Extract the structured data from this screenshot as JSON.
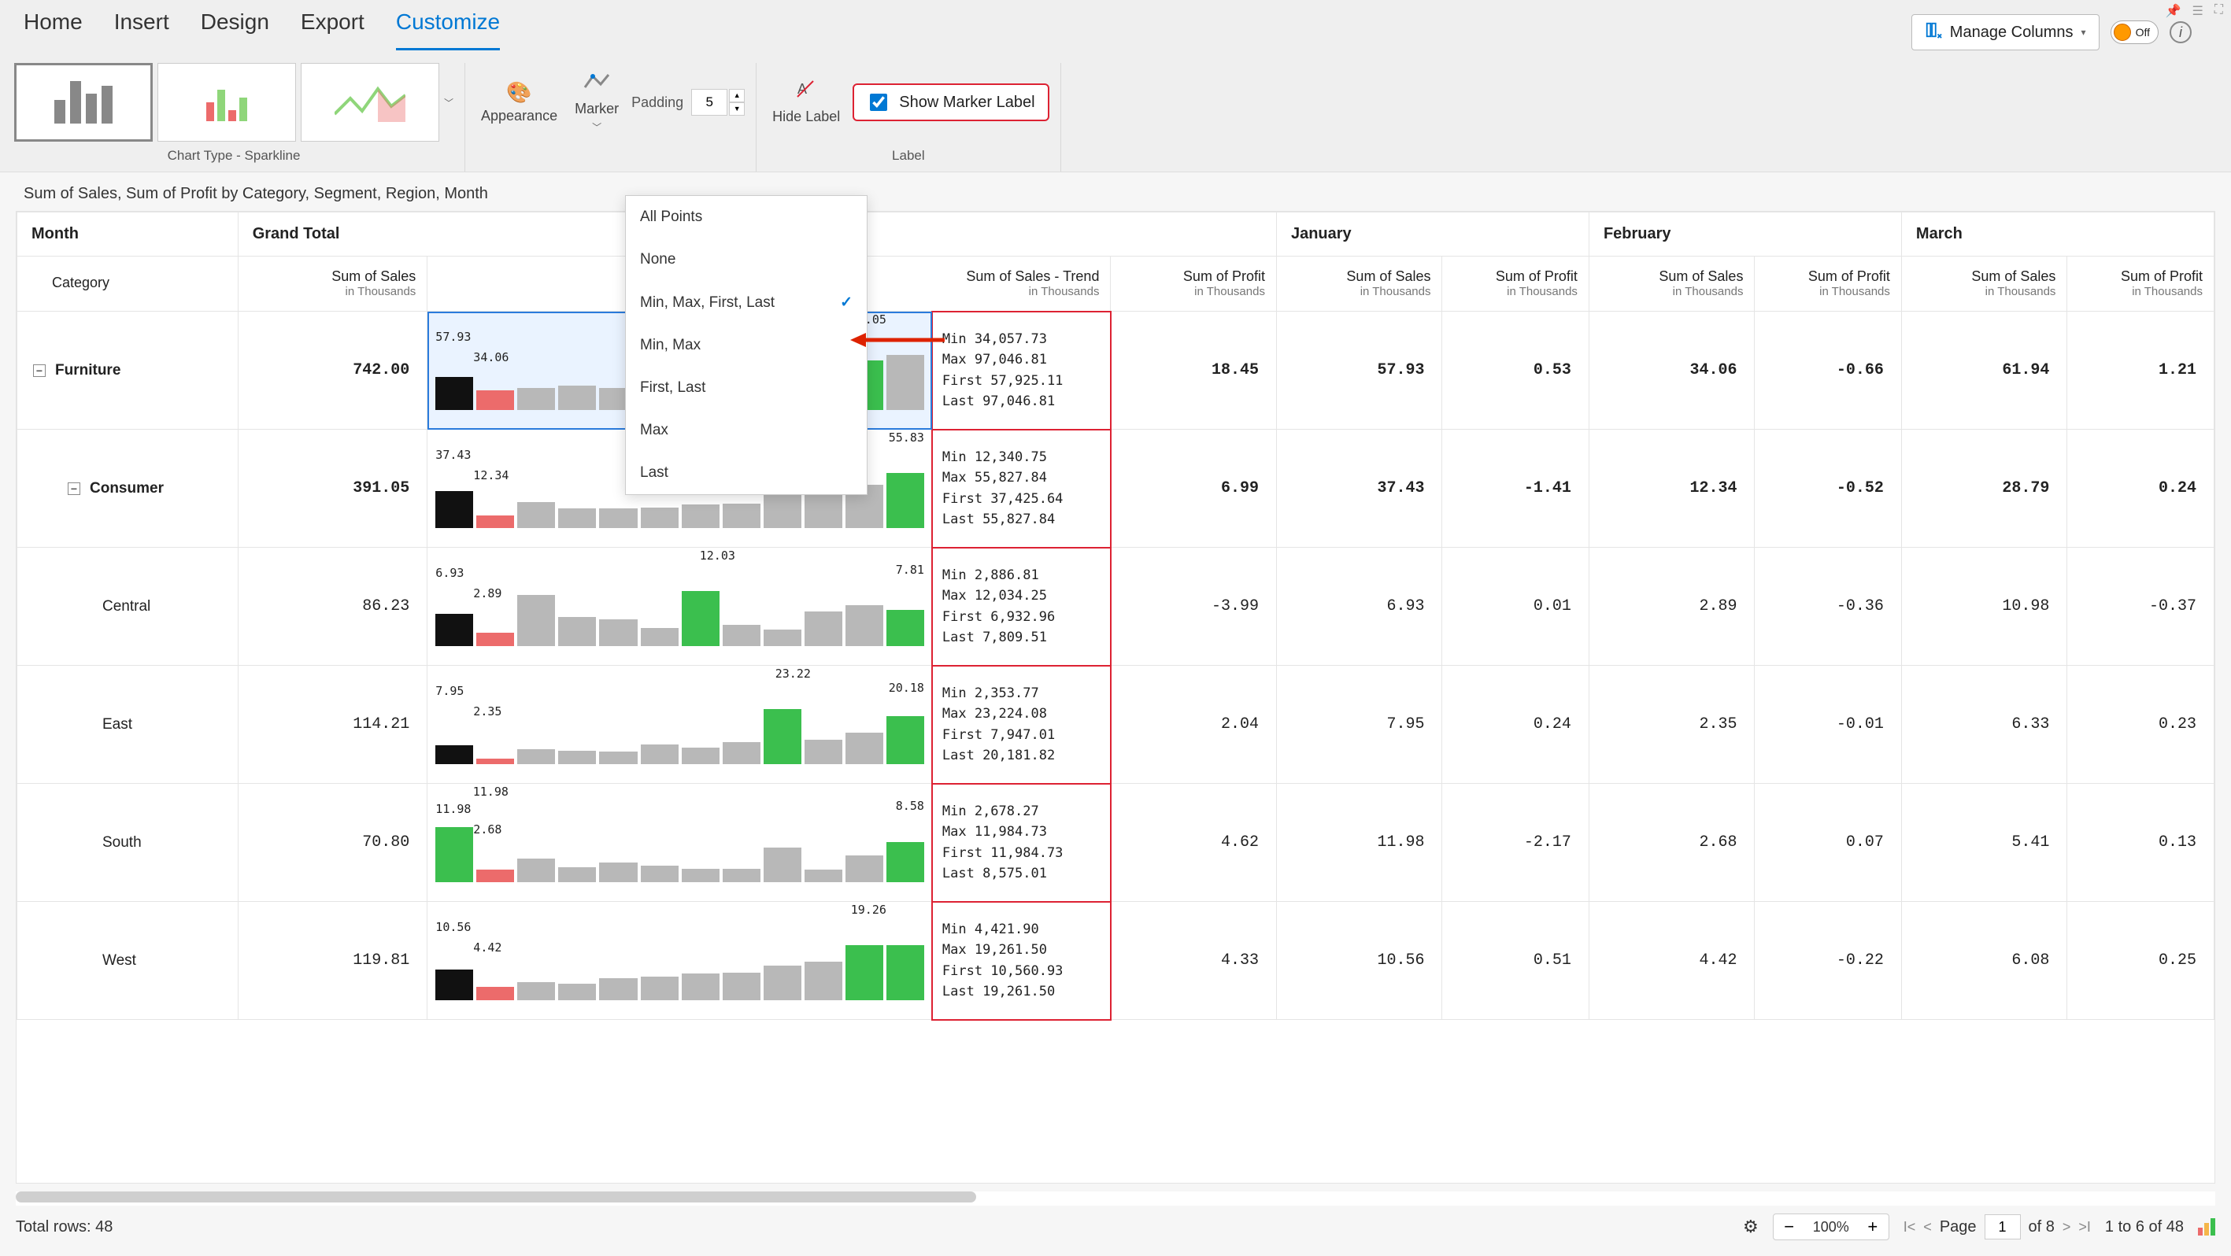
{
  "menu": {
    "home": "Home",
    "insert": "Insert",
    "design": "Design",
    "export": "Export",
    "customize": "Customize"
  },
  "ribbon": {
    "chart_type_label": "Chart Type - Sparkline",
    "appearance": "Appearance",
    "marker": "Marker",
    "padding_label": "Padding",
    "padding_value": "5",
    "hide_label": "Hide Label",
    "show_marker_label": "Show Marker Label",
    "manage_columns": "Manage Columns",
    "toggle_off": "Off",
    "label_group": "Label"
  },
  "marker_menu": {
    "all_points": "All Points",
    "none": "None",
    "min_max_first_last": "Min, Max, First, Last",
    "min_max": "Min, Max",
    "first_last": "First, Last",
    "max": "Max",
    "last": "Last"
  },
  "report_title": "Sum of Sales, Sum of Profit by Category, Segment, Region, Month",
  "headers": {
    "month": "Month",
    "grand_total": "Grand Total",
    "category": "Category",
    "january": "January",
    "february": "February",
    "march": "March",
    "sum_of_sales": "Sum of Sales",
    "sum_of_sales_trend": "Sum of Sales - Trend",
    "sum_of_profit": "Sum of Profit",
    "in_thousands": "in Thousands"
  },
  "rows": [
    {
      "name": "Furniture",
      "bold": true,
      "expand": true,
      "indent": 0,
      "grand_total": "742.00",
      "spark": {
        "first": "57.93",
        "min": "34.06",
        "max": "97.05",
        "heights": [
          59,
          35,
          40,
          44,
          40,
          52,
          38,
          40,
          42,
          66,
          90,
          100
        ],
        "minIdx": 1,
        "maxIdx": 10,
        "lastIdx": 10,
        "selected": true
      },
      "marker": {
        "min": "Min 34,057.73",
        "max": "Max 97,046.81",
        "first": "First 57,925.11",
        "last": "Last 97,046.81"
      },
      "profit_total": "18.45",
      "jan_s": "57.93",
      "jan_p": "0.53",
      "feb_s": "34.06",
      "feb_p": "-0.66",
      "mar_s": "61.94",
      "mar_p": "1.21"
    },
    {
      "name": "Consumer",
      "bold": true,
      "expand": true,
      "indent": 1,
      "grand_total": "391.05",
      "spark": {
        "first": "37.43",
        "min": "12.34",
        "max": "55.83",
        "heights": [
          67,
          22,
          46,
          35,
          35,
          37,
          42,
          44,
          62,
          74,
          78,
          100
        ],
        "minIdx": 1,
        "maxIdx": 11,
        "lastIdx": 11
      },
      "marker": {
        "min": "Min 12,340.75",
        "max": "Max 55,827.84",
        "first": "First 37,425.64",
        "last": "Last 55,827.84"
      },
      "profit_total": "6.99",
      "jan_s": "37.43",
      "jan_p": "-1.41",
      "feb_s": "12.34",
      "feb_p": "-0.52",
      "mar_s": "28.79",
      "mar_p": "0.24"
    },
    {
      "name": "Central",
      "bold": false,
      "indent": 2,
      "grand_total": "86.23",
      "spark": {
        "first": "6.93",
        "min": "2.89",
        "max": "12.03",
        "last": "7.81",
        "heights": [
          58,
          24,
          92,
          52,
          48,
          32,
          100,
          38,
          30,
          62,
          74,
          65
        ],
        "minIdx": 1,
        "maxIdx": 6,
        "lastIdx": 11
      },
      "marker": {
        "min": "Min 2,886.81",
        "max": "Max 12,034.25",
        "first": "First 6,932.96",
        "last": "Last 7,809.51"
      },
      "profit_total": "-3.99",
      "jan_s": "6.93",
      "jan_p": "0.01",
      "feb_s": "2.89",
      "feb_p": "-0.36",
      "mar_s": "10.98",
      "mar_p": "-0.37"
    },
    {
      "name": "East",
      "bold": false,
      "indent": 2,
      "grand_total": "114.21",
      "spark": {
        "first": "7.95",
        "min": "2.35",
        "max": "23.22",
        "last": "20.18",
        "heights": [
          34,
          10,
          27,
          24,
          22,
          35,
          30,
          40,
          100,
          44,
          56,
          87
        ],
        "minIdx": 1,
        "maxIdx": 8,
        "lastIdx": 11
      },
      "marker": {
        "min": "Min 2,353.77",
        "max": "Max 23,224.08",
        "first": "First 7,947.01",
        "last": "Last 20,181.82"
      },
      "profit_total": "2.04",
      "jan_s": "7.95",
      "jan_p": "0.24",
      "feb_s": "2.35",
      "feb_p": "-0.01",
      "mar_s": "6.33",
      "mar_p": "0.23"
    },
    {
      "name": "South",
      "bold": false,
      "indent": 2,
      "grand_total": "70.80",
      "spark": {
        "first": "11.98",
        "min": "2.68",
        "max": "11.98",
        "last": "8.58",
        "heights": [
          100,
          22,
          42,
          26,
          35,
          30,
          24,
          24,
          62,
          22,
          48,
          72
        ],
        "minIdx": 1,
        "maxIdx": 0,
        "lastIdx": 11
      },
      "marker": {
        "min": "Min 2,678.27",
        "max": "Max 11,984.73",
        "first": "First 11,984.73",
        "last": "Last 8,575.01"
      },
      "profit_total": "4.62",
      "jan_s": "11.98",
      "jan_p": "-2.17",
      "feb_s": "2.68",
      "feb_p": "0.07",
      "mar_s": "5.41",
      "mar_p": "0.13"
    },
    {
      "name": "West",
      "bold": false,
      "indent": 2,
      "grand_total": "119.81",
      "spark": {
        "first": "10.56",
        "min": "4.42",
        "max": "19.26",
        "heights": [
          55,
          23,
          32,
          30,
          40,
          42,
          48,
          50,
          62,
          70,
          100,
          100
        ],
        "minIdx": 1,
        "maxIdx": 10,
        "lastIdx": 11
      },
      "marker": {
        "min": "Min 4,421.90",
        "max": "Max 19,261.50",
        "first": "First 10,560.93",
        "last": "Last 19,261.50"
      },
      "profit_total": "4.33",
      "jan_s": "10.56",
      "jan_p": "0.51",
      "feb_s": "4.42",
      "feb_p": "-0.22",
      "mar_s": "6.08",
      "mar_p": "0.25"
    }
  ],
  "status": {
    "total_rows_label": "Total rows: 48",
    "zoom_pct": "100%",
    "page_label": "Page",
    "page_current": "1",
    "page_of": "of 8",
    "range": "1 to 6 of 48"
  },
  "chart_data": {
    "type": "table-with-sparklines",
    "title": "Sum of Sales, Sum of Profit by Category, Segment, Region, Month",
    "value_unit": "Thousands",
    "month_columns": [
      "January",
      "February",
      "March"
    ],
    "measures": [
      "Sum of Sales",
      "Sum of Profit"
    ],
    "rows": [
      {
        "level": "Category",
        "name": "Furniture",
        "grand_total_sales": 742.0,
        "grand_total_profit": 18.45,
        "months": {
          "January": {
            "sales": 57.93,
            "profit": 0.53
          },
          "February": {
            "sales": 34.06,
            "profit": -0.66
          },
          "March": {
            "sales": 61.94,
            "profit": 1.21
          }
        },
        "sparkline_markers": {
          "min": 34057.73,
          "max": 97046.81,
          "first": 57925.11,
          "last": 97046.81
        }
      },
      {
        "level": "Segment",
        "name": "Consumer",
        "grand_total_sales": 391.05,
        "grand_total_profit": 6.99,
        "months": {
          "January": {
            "sales": 37.43,
            "profit": -1.41
          },
          "February": {
            "sales": 12.34,
            "profit": -0.52
          },
          "March": {
            "sales": 28.79,
            "profit": 0.24
          }
        },
        "sparkline_markers": {
          "min": 12340.75,
          "max": 55827.84,
          "first": 37425.64,
          "last": 55827.84
        }
      },
      {
        "level": "Region",
        "name": "Central",
        "grand_total_sales": 86.23,
        "grand_total_profit": -3.99,
        "months": {
          "January": {
            "sales": 6.93,
            "profit": 0.01
          },
          "February": {
            "sales": 2.89,
            "profit": -0.36
          },
          "March": {
            "sales": 10.98,
            "profit": -0.37
          }
        },
        "sparkline_markers": {
          "min": 2886.81,
          "max": 12034.25,
          "first": 6932.96,
          "last": 7809.51
        }
      },
      {
        "level": "Region",
        "name": "East",
        "grand_total_sales": 114.21,
        "grand_total_profit": 2.04,
        "months": {
          "January": {
            "sales": 7.95,
            "profit": 0.24
          },
          "February": {
            "sales": 2.35,
            "profit": -0.01
          },
          "March": {
            "sales": 6.33,
            "profit": 0.23
          }
        },
        "sparkline_markers": {
          "min": 2353.77,
          "max": 23224.08,
          "first": 7947.01,
          "last": 20181.82
        }
      },
      {
        "level": "Region",
        "name": "South",
        "grand_total_sales": 70.8,
        "grand_total_profit": 4.62,
        "months": {
          "January": {
            "sales": 11.98,
            "profit": -2.17
          },
          "February": {
            "sales": 2.68,
            "profit": 0.07
          },
          "March": {
            "sales": 5.41,
            "profit": 0.13
          }
        },
        "sparkline_markers": {
          "min": 2678.27,
          "max": 11984.73,
          "first": 11984.73,
          "last": 8575.01
        }
      },
      {
        "level": "Region",
        "name": "West",
        "grand_total_sales": 119.81,
        "grand_total_profit": 4.33,
        "months": {
          "January": {
            "sales": 10.56,
            "profit": 0.51
          },
          "February": {
            "sales": 4.42,
            "profit": -0.22
          },
          "March": {
            "sales": 6.08,
            "profit": 0.25
          }
        },
        "sparkline_markers": {
          "min": 4421.9,
          "max": 19261.5,
          "first": 10560.93,
          "last": 19261.5
        }
      }
    ]
  }
}
